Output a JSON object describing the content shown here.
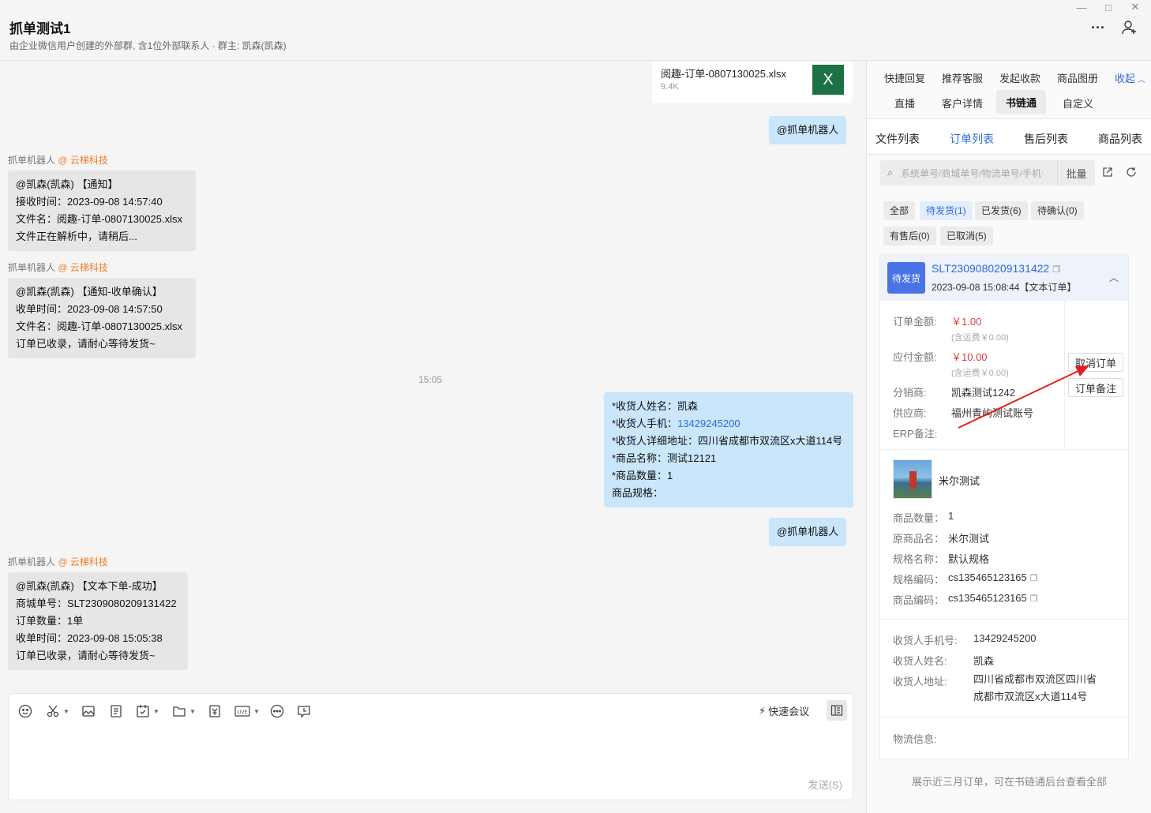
{
  "window": {
    "minimize": "—",
    "maximize": "□",
    "close": "✕"
  },
  "header": {
    "title": "抓单测试1",
    "subtitle": "由企业微信用户创建的外部群, 含1位外部联系人 · 群主: 凯森(凯森)",
    "more_icon": "···"
  },
  "chat": {
    "file": {
      "name": "阅趣-订单-0807130025.xlsx",
      "size": "9.4K",
      "icon_text": "X"
    },
    "mention1": "@抓单机器人",
    "msg1": {
      "sender": "抓单机器人",
      "org": "@ 云梯科技",
      "lines": [
        "@凯森(凯森) 【通知】",
        "接收时间：2023-09-08 14:57:40",
        "文件名：阅趣-订单-0807130025.xlsx",
        "文件正在解析中，请稍后..."
      ]
    },
    "msg2": {
      "sender": "抓单机器人",
      "org": "@ 云梯科技",
      "lines": [
        "@凯森(凯森) 【通知-收单确认】",
        "收单时间：2023-09-08 14:57:50",
        "文件名：阅趣-订单-0807130025.xlsx",
        "订单已收录，请耐心等待发货~"
      ]
    },
    "time_sep": "15:05",
    "order_msg": {
      "l1": "*收货人姓名：凯森",
      "l2_label": "*收货人手机：",
      "l2_value": "13429245200",
      "l3": "*收货人详细地址：四川省成都市双流区x大道114号",
      "l4": "*商品名称：测试12121",
      "l5": "*商品数量：1",
      "l6": "商品规格："
    },
    "mention2": "@抓单机器人",
    "msg3": {
      "sender": "抓单机器人",
      "org": "@ 云梯科技",
      "lines": [
        "@凯森(凯森) 【文本下单-成功】",
        "商城单号：SLT2309080209131422",
        "订单数量：1单",
        "收单时间：2023-09-08 15:05:38",
        "订单已收录，请耐心等待发货~"
      ]
    }
  },
  "input": {
    "meeting": "快速会议",
    "send": "发送(S)",
    "toolbar_icons": [
      "emoji-icon",
      "scissors-icon",
      "image-icon",
      "document-icon",
      "todo-icon",
      "folder-icon",
      "red-packet-icon",
      "live-icon",
      "more-circle-icon",
      "chat-record-icon"
    ]
  },
  "panel": {
    "tabs_row1": [
      "快捷回复",
      "推荐客服",
      "发起收款",
      "商品图册"
    ],
    "collapse": "收起",
    "tabs_row2": [
      "直播",
      "客户详情",
      "书链通",
      "自定义"
    ],
    "sub_tabs": [
      "文件列表",
      "订单列表",
      "售后列表",
      "商品列表"
    ],
    "search_placeholder": "系统单号/商城单号/物流单号/手机号",
    "batch": "批量",
    "filters": [
      "全部",
      "待发货(1)",
      "已发货(6)",
      "待确认(0)",
      "有售后(0)",
      "已取消(5)"
    ],
    "order": {
      "status": "待发货",
      "order_no": "SLT2309080209131422",
      "time": "2023-09-08 15:08:44【文本订单】",
      "amount_label": "订单金额:",
      "amount": "￥1.00",
      "amount_note": "(含运费￥0.00)",
      "payable_label": "应付金额:",
      "payable": "￥10.00",
      "payable_note": "(含运费￥0.00)",
      "distributor_label": "分销商:",
      "distributor": "凯森测试1242",
      "supplier_label": "供应商:",
      "supplier": "福州青屿测试账号",
      "erp_label": "ERP备注:",
      "cancel_btn": "取消订单",
      "remark_btn": "订单备注",
      "product_name": "米尔测试",
      "qty_label": "商品数量：",
      "qty": "1",
      "orig_label": "原商品名：",
      "orig": "米尔测试",
      "spec_label": "规格名称：",
      "spec": "默认规格",
      "spec_code_label": "规格编码：",
      "spec_code": "cs135465123165",
      "goods_code_label": "商品编码：",
      "goods_code": "cs135465123165",
      "phone_label": "收货人手机号:",
      "phone": "13429245200",
      "name_label": "收货人姓名:",
      "name": "凯森",
      "addr_label": "收货人地址:",
      "addr1": "四川省成都市双流区四川省",
      "addr2": "成都市双流区x大道114号",
      "logistics_label": "物流信息:"
    },
    "footnote": "展示近三月订单，可在书链通后台查看全部"
  }
}
